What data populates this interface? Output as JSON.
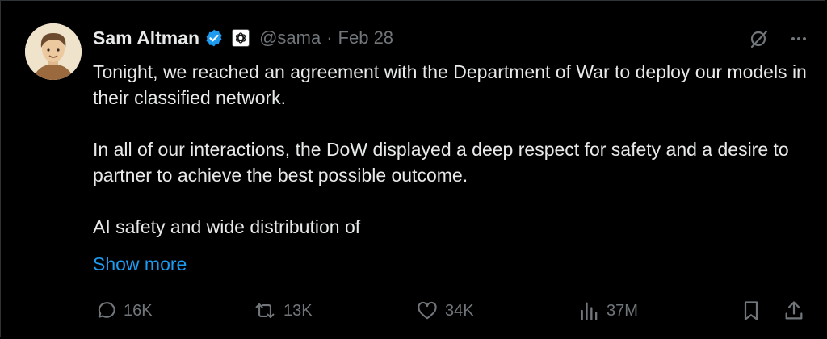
{
  "tweet": {
    "author_name": "Sam Altman",
    "handle": "@sama",
    "separator": "·",
    "date": "Feb 28",
    "paragraphs": [
      "Tonight, we reached an agreement with the Department of War to deploy our models in their classified network.",
      "In all of our interactions, the DoW displayed a deep respect for safety and a desire to partner to achieve the best possible outcome.",
      "AI safety and wide distribution of"
    ],
    "show_more": "Show more"
  },
  "actions": {
    "replies": "16K",
    "reposts": "13K",
    "likes": "34K",
    "views": "37M"
  },
  "icons": {
    "verified": "verified-badge-icon",
    "org": "openai-logo-icon",
    "grok": "grok-icon",
    "more": "more-icon",
    "reply": "reply-icon",
    "repost": "repost-icon",
    "like": "heart-icon",
    "views": "views-icon",
    "bookmark": "bookmark-icon",
    "share": "share-icon"
  },
  "colors": {
    "background": "#000000",
    "text": "#e7e9ea",
    "secondary": "#71767b",
    "accent": "#1d9bf0"
  }
}
